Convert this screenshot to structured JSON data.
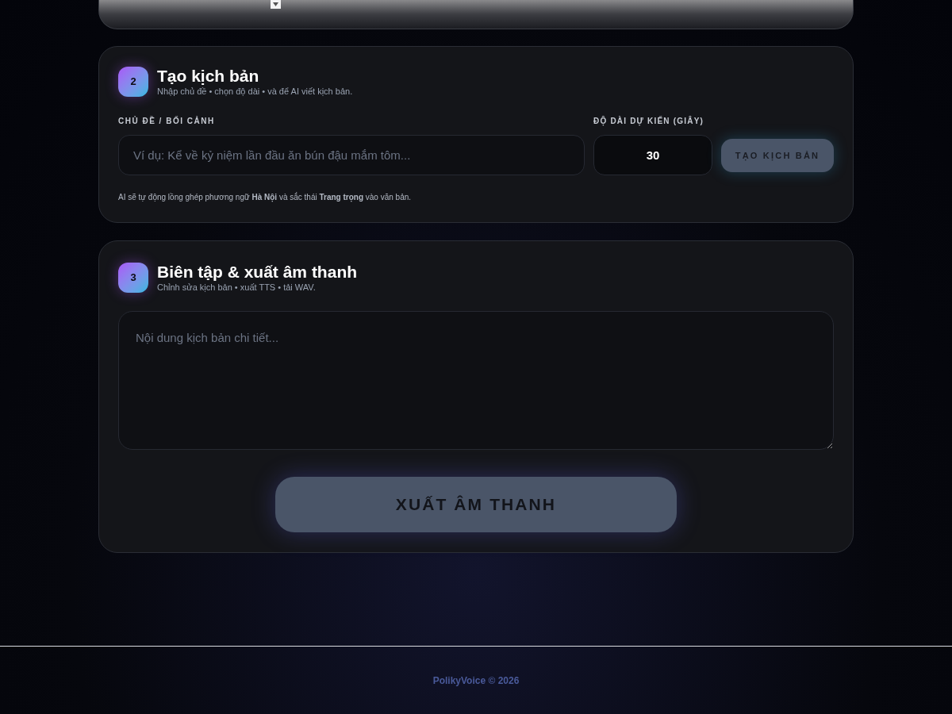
{
  "steps": [
    {
      "number": "2",
      "title": "Tạo kịch bản",
      "subtitle": "Nhập chủ đề • chọn độ dài • và để AI viết kịch bản.",
      "topic": {
        "label": "CHỦ ĐỀ / BỐI CẢNH",
        "placeholder": "Ví dụ: Kể về kỷ niệm lần đầu ăn bún đậu mắm tôm..."
      },
      "duration": {
        "label": "ĐỘ DÀI DỰ KIẾN (GIÂY)",
        "value": "30"
      },
      "button": "TẠO KỊCH BẢN",
      "note": "AI sẽ tự động lồng ghép phương ngữ **Hà Nội** và sắc thái **Trang trọng** vào văn bản."
    },
    {
      "number": "3",
      "title": "Biên tập & xuất âm thanh",
      "subtitle": "Chỉnh sửa kịch bản • xuất TTS • tải WAV.",
      "script": {
        "placeholder": "Nội dung kịch bản chi tiết..."
      },
      "button": "XUẤT ÂM THANH"
    }
  ],
  "footer": "PolikyVoice © 2026"
}
